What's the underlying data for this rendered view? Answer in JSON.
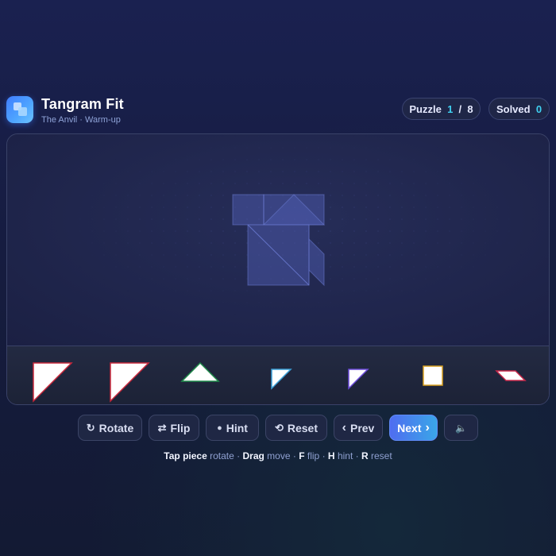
{
  "app": {
    "title": "Tangram Fit",
    "subtitle": "The Anvil · Warm-up"
  },
  "status": {
    "puzzle_label": "Puzzle",
    "puzzle_current": "1",
    "puzzle_sep": "/",
    "puzzle_total": "8",
    "solved_label": "Solved",
    "solved_count": "0"
  },
  "tray_pieces": [
    {
      "id": "large-triangle-1",
      "outline": "#c8283c"
    },
    {
      "id": "large-triangle-2",
      "outline": "#c8283c"
    },
    {
      "id": "medium-triangle",
      "outline": "#1f8a4a"
    },
    {
      "id": "small-triangle-1",
      "outline": "#3aa0d8"
    },
    {
      "id": "small-triangle-2",
      "outline": "#6a4ad8"
    },
    {
      "id": "square",
      "outline": "#d8a020"
    },
    {
      "id": "parallelogram",
      "outline": "#c8284a"
    }
  ],
  "controls": {
    "rotate": "Rotate",
    "flip": "Flip",
    "hint": "Hint",
    "reset": "Reset",
    "prev": "Prev",
    "next": "Next"
  },
  "icons": {
    "rotate": "↻",
    "flip": "⇄",
    "hint": "●",
    "reset": "⟲",
    "prev": "‹",
    "next": "›",
    "sound": "🔈"
  },
  "help": {
    "tap": "Tap piece",
    "tap_action": "rotate",
    "drag": "Drag",
    "drag_action": "move",
    "f": "F",
    "f_action": "flip",
    "h": "H",
    "h_action": "hint",
    "r": "R",
    "r_action": "reset",
    "sep": "·"
  },
  "colors": {
    "accent": "#3fd0f0",
    "next_button_start": "#4f6df0",
    "next_button_end": "#3aa6e8",
    "silhouette_fill": "#4a58a8"
  }
}
